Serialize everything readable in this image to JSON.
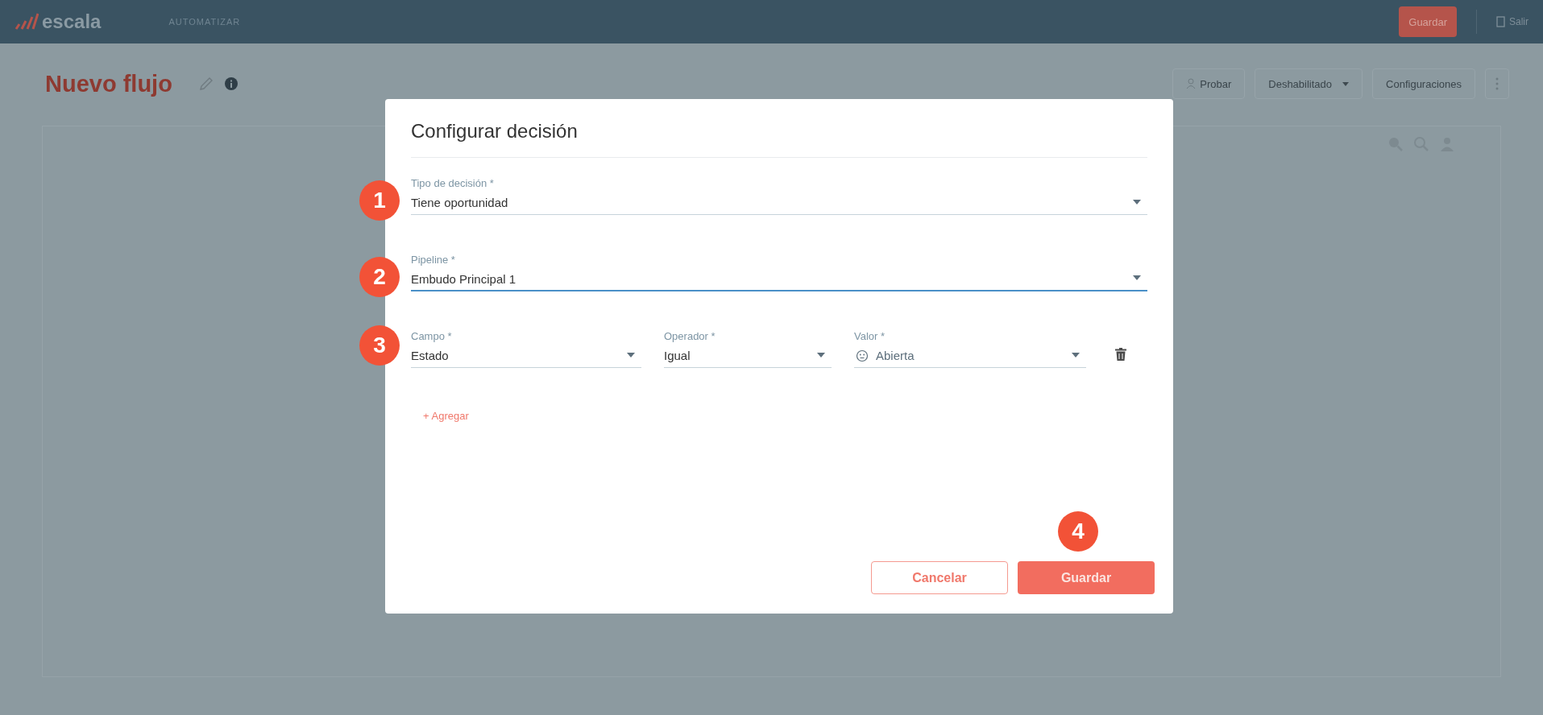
{
  "topbar": {
    "logo": "escala",
    "nav": "AUTOMATIZAR",
    "save_button": "Guardar",
    "exit": "Salir"
  },
  "header": {
    "title": "Nuevo flujo",
    "actions": [
      {
        "label": "Probar",
        "kind": "icon"
      },
      {
        "label": "Deshabilitado",
        "kind": "dropdown"
      },
      {
        "label": "Configuraciones",
        "kind": "plain"
      }
    ]
  },
  "dialog": {
    "title": "Configurar decisión",
    "fields": [
      {
        "label": "Tipo de decisión *",
        "value": "Tiene oportunidad",
        "focused": false,
        "badge": "1"
      },
      {
        "label": "Pipeline *",
        "value": "Embudo Principal 1",
        "focused": true,
        "badge": "2"
      }
    ],
    "condition": {
      "badge": "3",
      "fields": [
        {
          "label": "Campo *",
          "value": "Estado",
          "kind": "select"
        },
        {
          "label": "Operador *",
          "value": "Igual",
          "kind": "select"
        },
        {
          "label": "Valor *",
          "value": "Abierta",
          "kind": "emoji-select"
        }
      ]
    },
    "add_link": "+ Agregar",
    "buttons": [
      {
        "label": "Cancelar",
        "kind": "outline"
      },
      {
        "label": "Guardar",
        "kind": "primary",
        "badge": "4"
      }
    ]
  }
}
